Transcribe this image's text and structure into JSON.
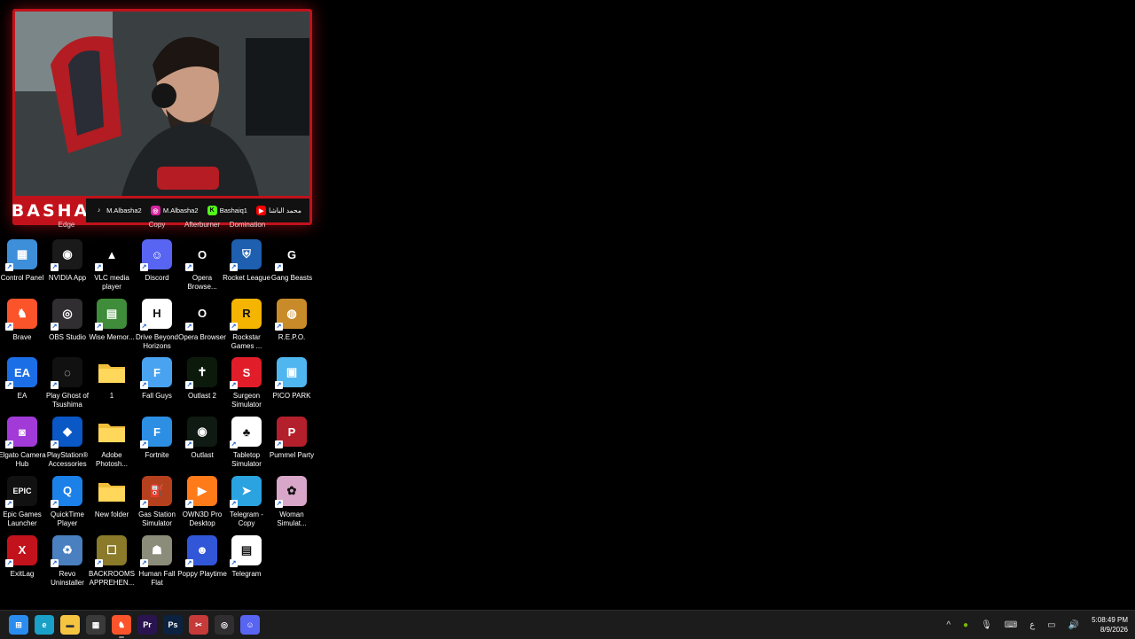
{
  "webcam": {
    "brand": "BASHA",
    "socials": [
      {
        "platform": "tiktok-icon",
        "handle": "M.Albasha2",
        "color": "#111111"
      },
      {
        "platform": "instagram-icon",
        "handle": "M.Albasha2",
        "color": "#d6249f"
      },
      {
        "platform": "kick-icon",
        "handle": "Bashaiq1",
        "color": "#53fc18"
      },
      {
        "platform": "youtube-icon",
        "handle": "محمد الباشا",
        "color": "#ff0000"
      }
    ]
  },
  "partial_labels": [
    "Edge",
    "Copy",
    "Afterburner",
    "Domination"
  ],
  "desktop_icons": [
    {
      "label": "Control Panel",
      "icon": "control-panel-icon",
      "color": "#3d8fd9",
      "glyph": "▦"
    },
    {
      "label": "NVIDIA App",
      "icon": "nvidia-icon",
      "color": "#1a1a1a",
      "glyph": "◉"
    },
    {
      "label": "VLC media player",
      "icon": "vlc-icon",
      "color": "#000000",
      "glyph": "▲"
    },
    {
      "label": "Discord",
      "icon": "discord-icon",
      "color": "#5865f2",
      "glyph": "☺"
    },
    {
      "label": "Opera Browse...",
      "icon": "opera-icon",
      "color": "#000000",
      "glyph": "O"
    },
    {
      "label": "Rocket League",
      "icon": "rocket-league-icon",
      "color": "#1e5fb0",
      "glyph": "⛨"
    },
    {
      "label": "Gang Beasts",
      "icon": "gang-beasts-icon",
      "color": "#000000",
      "glyph": "G"
    },
    {
      "label": "Brave",
      "icon": "brave-icon",
      "color": "#fb542b",
      "glyph": "♞"
    },
    {
      "label": "OBS Studio",
      "icon": "obs-icon",
      "color": "#302e31",
      "glyph": "◎"
    },
    {
      "label": "Wise Memor...",
      "icon": "wise-memory-icon",
      "color": "#3f8c3a",
      "glyph": "▤"
    },
    {
      "label": "Drive Beyond Horizons",
      "icon": "drive-beyond-horizons-icon",
      "color": "#ffffff",
      "glyph": "H"
    },
    {
      "label": "Opera Browser",
      "icon": "opera-icon",
      "color": "#000000",
      "glyph": "O"
    },
    {
      "label": "Rockstar Games ...",
      "icon": "rockstar-icon",
      "color": "#f4b400",
      "glyph": "R"
    },
    {
      "label": "R.E.P.O.",
      "icon": "repo-icon",
      "color": "#c98b2a",
      "glyph": "◍"
    },
    {
      "label": "EA",
      "icon": "ea-icon",
      "color": "#1b6ee6",
      "glyph": "EA"
    },
    {
      "label": "Play Ghost of Tsushima",
      "icon": "ghost-of-tsushima-icon",
      "color": "#111111",
      "glyph": "◌"
    },
    {
      "label": "1",
      "icon": "folder-icon",
      "color": "#f5c542",
      "glyph": ""
    },
    {
      "label": "Fall Guys",
      "icon": "fall-guys-icon",
      "color": "#4aa3f0",
      "glyph": "F"
    },
    {
      "label": "Outlast 2",
      "icon": "outlast-2-icon",
      "color": "#0c1a0c",
      "glyph": "✝"
    },
    {
      "label": "Surgeon Simulator",
      "icon": "surgeon-simulator-icon",
      "color": "#e11d2a",
      "glyph": "S"
    },
    {
      "label": "PICO PARK",
      "icon": "pico-park-icon",
      "color": "#4fb6f0",
      "glyph": "▣"
    },
    {
      "label": "Elgato Camera Hub",
      "icon": "elgato-icon",
      "color": "#a23ad8",
      "glyph": "◙"
    },
    {
      "label": "PlayStation® Accessories",
      "icon": "playstation-icon",
      "color": "#0a57c6",
      "glyph": "◆"
    },
    {
      "label": "Adobe Photosh...",
      "icon": "folder-icon",
      "color": "#f5c542",
      "glyph": ""
    },
    {
      "label": "Fortnite",
      "icon": "fortnite-icon",
      "color": "#2d8fe3",
      "glyph": "F"
    },
    {
      "label": "Outlast",
      "icon": "outlast-icon",
      "color": "#0f1a12",
      "glyph": "◉"
    },
    {
      "label": "Tabletop Simulator",
      "icon": "tabletop-simulator-icon",
      "color": "#ffffff",
      "glyph": "♣"
    },
    {
      "label": "Pummel Party",
      "icon": "pummel-party-icon",
      "color": "#b3202c",
      "glyph": "P"
    },
    {
      "label": "Epic Games Launcher",
      "icon": "epic-games-icon",
      "color": "#111111",
      "glyph": "EPIC"
    },
    {
      "label": "QuickTime Player",
      "icon": "quicktime-icon",
      "color": "#1b80e8",
      "glyph": "Q"
    },
    {
      "label": "New folder",
      "icon": "folder-icon",
      "color": "#f5c542",
      "glyph": ""
    },
    {
      "label": "Gas Station Simulator",
      "icon": "gas-station-simulator-icon",
      "color": "#b5401e",
      "glyph": "⛽"
    },
    {
      "label": "OWN3D Pro Desktop",
      "icon": "own3d-icon",
      "color": "#ff7a18",
      "glyph": "▶"
    },
    {
      "label": "Telegram - Copy",
      "icon": "telegram-icon",
      "color": "#2aa3e0",
      "glyph": "➤"
    },
    {
      "label": "Woman Simulat...",
      "icon": "woman-simulator-icon",
      "color": "#d8a6c8",
      "glyph": "✿"
    },
    {
      "label": "ExitLag",
      "icon": "exitlag-icon",
      "color": "#c2121c",
      "glyph": "X"
    },
    {
      "label": "Revo Uninstaller",
      "icon": "revo-uninstaller-icon",
      "color": "#4a7fc0",
      "glyph": "♻"
    },
    {
      "label": "BACKROOMS APPREHEN...",
      "icon": "backrooms-icon",
      "color": "#8a7a2a",
      "glyph": "☐"
    },
    {
      "label": "Human Fall Flat",
      "icon": "human-fall-flat-icon",
      "color": "#8c8c7a",
      "glyph": "☗"
    },
    {
      "label": "Poppy Playtime",
      "icon": "poppy-playtime-icon",
      "color": "#3156d8",
      "glyph": "☻"
    },
    {
      "label": "Telegram",
      "icon": "telegram-file-icon",
      "color": "#ffffff",
      "glyph": "▤"
    }
  ],
  "taskbar": {
    "apps": [
      {
        "name": "start-icon",
        "color": "#2b8cf0",
        "glyph": "⊞"
      },
      {
        "name": "edge-icon",
        "color": "#1aa0c8",
        "glyph": "e"
      },
      {
        "name": "file-explorer-icon",
        "color": "#f5c542",
        "glyph": "▬"
      },
      {
        "name": "microsoft-store-icon",
        "color": "#3a3a3a",
        "glyph": "▦"
      },
      {
        "name": "brave-icon",
        "color": "#fb542b",
        "glyph": "♞"
      },
      {
        "name": "premiere-pro-icon",
        "color": "#2a1450",
        "glyph": "Pr"
      },
      {
        "name": "photoshop-icon",
        "color": "#0b2340",
        "glyph": "Ps"
      },
      {
        "name": "snipping-icon",
        "color": "#c63a3a",
        "glyph": "✂"
      },
      {
        "name": "obs-icon",
        "color": "#302e31",
        "glyph": "◎"
      },
      {
        "name": "discord-icon",
        "color": "#5865f2",
        "glyph": "☺"
      }
    ],
    "tray": {
      "chevron": "^",
      "language": "ع",
      "time": "5:08:49 PM",
      "date": "8/9/2026"
    }
  }
}
